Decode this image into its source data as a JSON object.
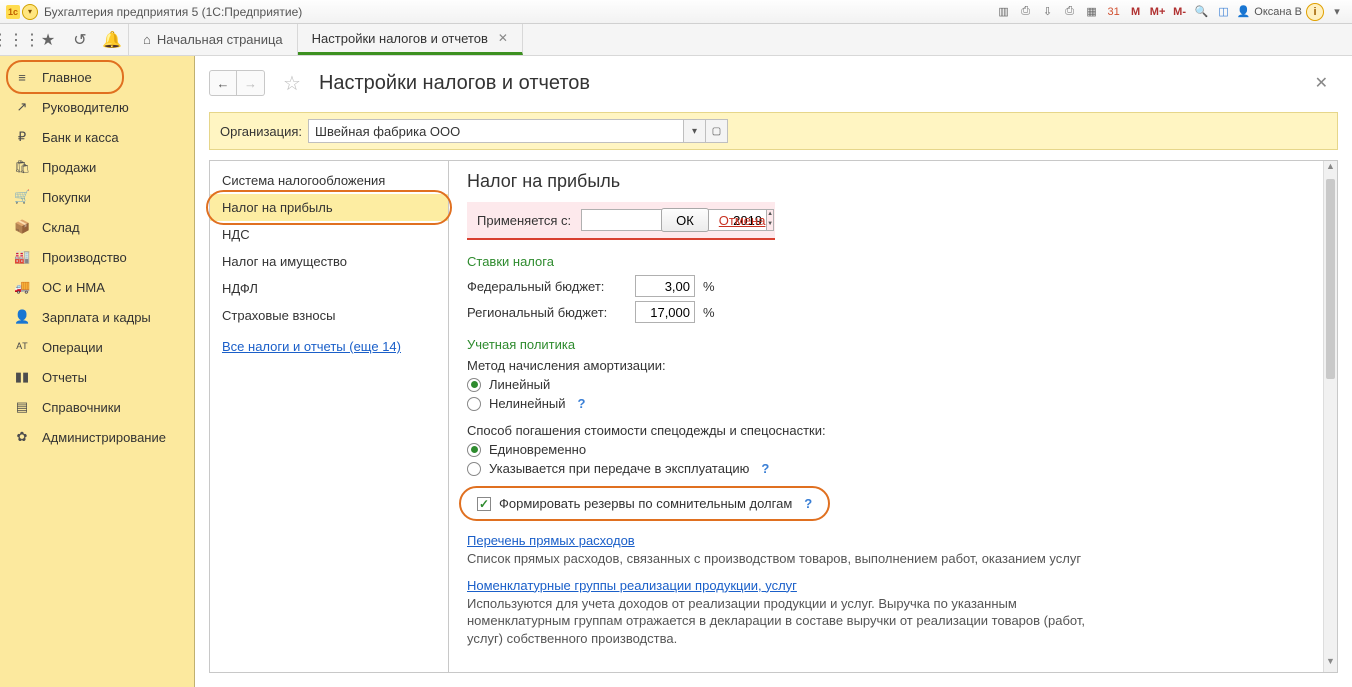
{
  "title": "Бухгалтерия предприятия 5  (1С:Предприятие)",
  "user": "Оксана В",
  "tabs": {
    "home": "Начальная страница",
    "active": "Настройки налогов и отчетов"
  },
  "sidebar": [
    {
      "icon": "≡",
      "label": "Главное",
      "sel": true
    },
    {
      "icon": "↗",
      "label": "Руководителю"
    },
    {
      "icon": "₽",
      "label": "Банк и касса"
    },
    {
      "icon": "🛍",
      "label": "Продажи"
    },
    {
      "icon": "🛒",
      "label": "Покупки"
    },
    {
      "icon": "📦",
      "label": "Склад"
    },
    {
      "icon": "🏭",
      "label": "Производство"
    },
    {
      "icon": "🚚",
      "label": "ОС и НМА"
    },
    {
      "icon": "👤",
      "label": "Зарплата и кадры"
    },
    {
      "icon": "ᴬᵀ",
      "label": "Операции"
    },
    {
      "icon": "▮▮",
      "label": "Отчеты"
    },
    {
      "icon": "▤",
      "label": "Справочники"
    },
    {
      "icon": "✿",
      "label": "Администрирование"
    }
  ],
  "page": {
    "title": "Настройки налогов и отчетов",
    "org_label": "Организация:",
    "org_value": "Швейная фабрика ООО"
  },
  "nav": {
    "items": [
      "Система налогообложения",
      "Налог на прибыль",
      "НДС",
      "Налог на имущество",
      "НДФЛ",
      "Страховые взносы"
    ],
    "link": "Все налоги и отчеты (еще 14)"
  },
  "pane": {
    "heading": "Налог на прибыль",
    "apply_label": "Применяется с:",
    "year": "2019",
    "ok": "ОК",
    "cancel": "Отмена",
    "rates_title": "Ставки налога",
    "fed_label": "Федеральный бюджет:",
    "fed_value": "3,00",
    "reg_label": "Региональный бюджет:",
    "reg_value": "17,000",
    "pct": "%",
    "policy_title": "Учетная политика",
    "amort_label": "Метод начисления амортизации:",
    "amort_linear": "Линейный",
    "amort_nonlinear": "Нелинейный",
    "spec_label": "Способ погашения стоимости спецодежды и спецоснастки:",
    "spec_once": "Единовременно",
    "spec_onuse": "Указывается при передаче в эксплуатацию",
    "reserve_label": "Формировать резервы по сомнительным долгам",
    "link1": "Перечень прямых расходов",
    "desc1": "Список прямых расходов, связанных с производством товаров, выполнением работ, оказанием услуг",
    "link2": "Номенклатурные группы реализации продукции, услуг",
    "desc2": "Используются для учета доходов от реализации продукции и услуг. Выручка по указанным номенклатурным группам отражается в декларации в составе выручки от реализации товаров (работ, услуг) собственного производства."
  }
}
